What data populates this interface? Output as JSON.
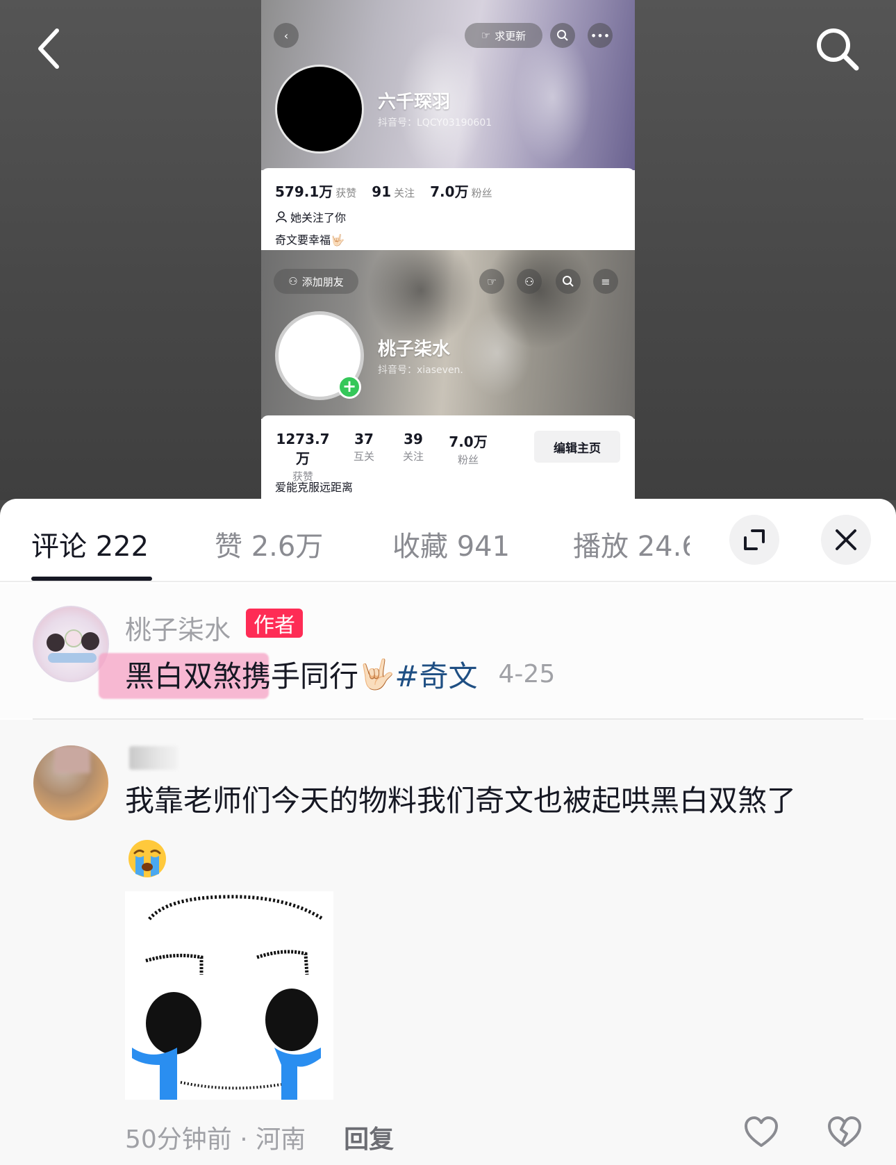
{
  "screenshot": {
    "profile1": {
      "want_update_label": "求更新",
      "name": "六千琛羽",
      "douyin_id": "抖音号：LQCY03190601",
      "stats": [
        {
          "value": "579.1万",
          "label": "获赞"
        },
        {
          "value": "91",
          "label": "关注"
        },
        {
          "value": "7.0万",
          "label": "粉丝"
        }
      ],
      "followed_you": "她关注了你",
      "bio": "奇文要幸福🤟🏻"
    },
    "profile2": {
      "add_friend_label": "添加朋友",
      "name": "桃子柒水",
      "douyin_id": "抖音号：xiaseven.",
      "stats": [
        {
          "value": "1273.7万",
          "label": "获赞"
        },
        {
          "value": "37",
          "label": "互关"
        },
        {
          "value": "39",
          "label": "关注"
        },
        {
          "value": "7.0万",
          "label": "粉丝"
        }
      ],
      "edit_label": "编辑主页",
      "bio": "爱能克服远距离"
    }
  },
  "tabs": {
    "comments": "评论 222",
    "likes": "赞 2.6万",
    "favorites": "收藏 941",
    "plays": "播放 24.6"
  },
  "author_comment": {
    "username": "桃子柒水",
    "badge": "作者",
    "highlighted_text": "黑白双煞",
    "text": " 携手同行",
    "emoji": "🤟🏻",
    "hashtag": "#奇文",
    "date": "4-25"
  },
  "comment": {
    "username": "…",
    "text": "我靠老师们今天的物料我们奇文也被起哄黑白双煞了",
    "emoji": "crying-face",
    "time_location": "50分钟前 · 河南",
    "reply_label": "回复"
  },
  "colors": {
    "author_badge": "#fe2c55",
    "hashtag": "#1f4f83",
    "highlight": "#f6a2c4",
    "online_plus": "#35c759"
  }
}
